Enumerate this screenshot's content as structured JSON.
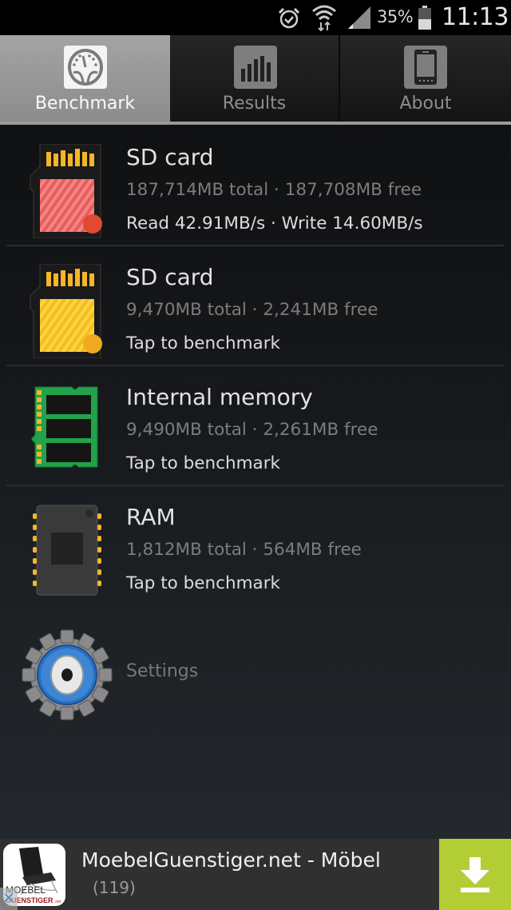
{
  "status_bar": {
    "icons": [
      "alarm-icon",
      "wifi-icon",
      "signal-icon",
      "battery-icon"
    ],
    "battery_percent": "35%",
    "time": "11:13"
  },
  "tabs": [
    {
      "label": "Benchmark",
      "icon": "speedometer-icon",
      "active": true
    },
    {
      "label": "Results",
      "icon": "bar-chart-icon",
      "active": false
    },
    {
      "label": "About",
      "icon": "phone-icon",
      "active": false
    }
  ],
  "storage_items": [
    {
      "title": "SD card",
      "subtitle": "187,714MB total · 187,708MB free",
      "status": "Read 42.91MB/s · Write 14.60MB/s",
      "icon": "sd-card-red-icon"
    },
    {
      "title": "SD card",
      "subtitle": "9,470MB total · 2,241MB free",
      "status": "Tap to benchmark",
      "icon": "sd-card-yellow-icon"
    },
    {
      "title": "Internal memory",
      "subtitle": "9,490MB total · 2,261MB free",
      "status": "Tap to benchmark",
      "icon": "memory-module-icon"
    },
    {
      "title": "RAM",
      "subtitle": "1,812MB total · 564MB free",
      "status": "Tap to benchmark",
      "icon": "ram-chip-icon"
    }
  ],
  "settings": {
    "label": "Settings",
    "icon": "gear-icon"
  },
  "ad": {
    "title": "MoebelGuenstiger.net - Möbel",
    "rating_count": "(119)",
    "logo_text_top": "MOEBEL",
    "logo_text_bottom": "GUENSTIGER",
    "logo_text_suffix": ".net",
    "close_glyph": "✕",
    "button_color": "#b3ce35"
  },
  "colors": {
    "active_tab": "#9a9a9a",
    "title_text": "#e2e2e2",
    "subtitle_text": "#7c7c7c"
  }
}
